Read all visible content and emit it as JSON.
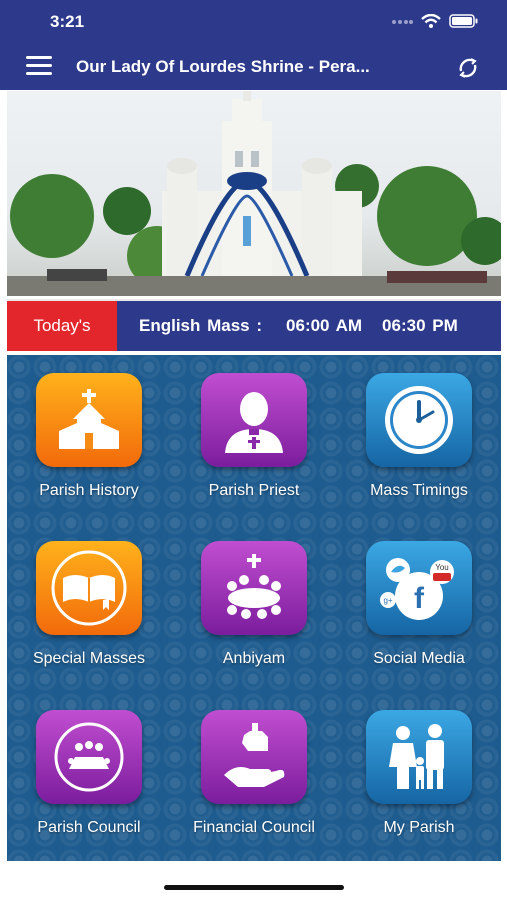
{
  "status": {
    "time": "3:21"
  },
  "navbar": {
    "title": "Our Lady Of Lourdes Shrine - Pera..."
  },
  "ticker": {
    "badge": "Today's",
    "label": "English Mass :",
    "times": [
      "06:00 AM",
      "06:30 PM"
    ]
  },
  "tiles": [
    {
      "label": "Parish History",
      "icon": "church-icon",
      "color": "#f7931e"
    },
    {
      "label": "Parish Priest",
      "icon": "priest-icon",
      "color": "#9b2fb5"
    },
    {
      "label": "Mass Timings",
      "icon": "clock-icon",
      "color": "#2a8fd0"
    },
    {
      "label": "Special Masses",
      "icon": "bible-icon",
      "color": "#f7931e"
    },
    {
      "label": "Anbiyam",
      "icon": "community-icon",
      "color": "#9b2fb5"
    },
    {
      "label": "Social Media",
      "icon": "social-media-icon",
      "color": "#2a8fd0"
    },
    {
      "label": "Parish Council",
      "icon": "meeting-icon",
      "color": "#9b2fb5"
    },
    {
      "label": "Financial Council",
      "icon": "donation-icon",
      "color": "#9b2fb5"
    },
    {
      "label": "My Parish",
      "icon": "family-icon",
      "color": "#2a8fd0"
    }
  ],
  "colors": {
    "header": "#2d3a8c",
    "badge": "#e3262b",
    "grid": "#1e5b8e"
  }
}
